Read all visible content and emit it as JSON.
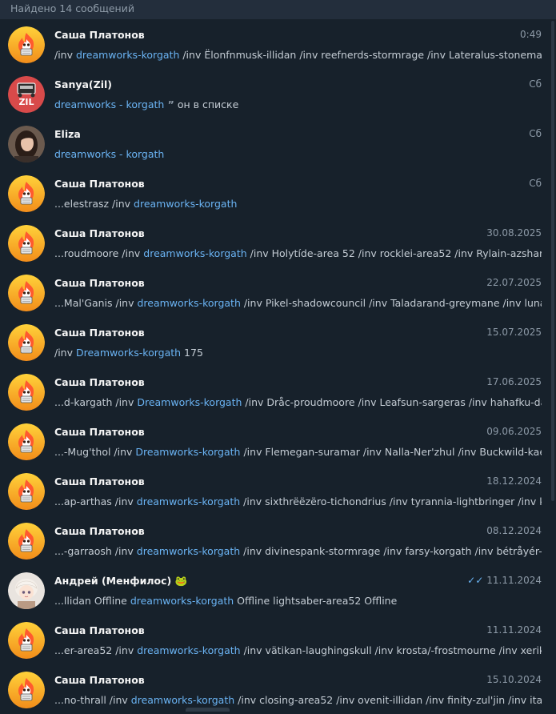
{
  "header": {
    "title": "Найдено 14 сообщений"
  },
  "results": [
    {
      "name": "Саша Платонов",
      "date": "0:49",
      "avatar": "fire-sticker",
      "pre": "/inv ",
      "hl": "dreamworks-korgath",
      "post": " /inv Ëlonfnmusk-illidan /inv reefnerds-stormrage /inv Lateralus-stonemaul"
    },
    {
      "name": "Sanya(Zil)",
      "date": "Сб",
      "avatar": "zil",
      "pre": "",
      "hl": "dreamworks - korgath",
      "quote": " ”",
      "post": " он в списке"
    },
    {
      "name": "Eliza",
      "date": "Сб",
      "avatar": "photo-eliza",
      "pre": "",
      "hl": "dreamworks - korgath",
      "post": ""
    },
    {
      "name": "Саша Платонов",
      "date": "Сб",
      "avatar": "fire-sticker",
      "pre": "...elestrasz /inv ",
      "hl": "dreamworks-korgath",
      "post": ""
    },
    {
      "name": "Саша Платонов",
      "date": "30.08.2025",
      "avatar": "fire-sticker",
      "pre": "...roudmoore /inv ",
      "hl": "dreamworks-korgath",
      "post": " /inv Holytíde-area 52 /inv rocklei-area52 /inv Rylain-azshara /i..."
    },
    {
      "name": "Саша Платонов",
      "date": "22.07.2025",
      "avatar": "fire-sticker",
      "pre": "...Mal'Ganis /inv ",
      "hl": "dreamworks-korgath",
      "post": " /inv Pikel-shadowcouncil /inv Taladarand-greymane /inv lunari..."
    },
    {
      "name": "Саша Платонов",
      "date": "15.07.2025",
      "avatar": "fire-sticker",
      "pre": "/inv ",
      "hl": "Dreamworks-korgath",
      "post": " 175"
    },
    {
      "name": "Саша Платонов",
      "date": "17.06.2025",
      "avatar": "fire-sticker",
      "pre": "...d-kargath /inv ",
      "hl": "Dreamworks-korgath",
      "post": " /inv Dråc-proudmoore /inv Leafsun-sargeras /inv hahafku-darr..."
    },
    {
      "name": "Саша Платонов",
      "date": "09.06.2025",
      "avatar": "fire-sticker",
      "pre": "...-Mug'thol /inv ",
      "hl": "Dreamworks-korgath",
      "post": " /inv Flemegan-suramar /inv Nalla-Ner'zhul /inv Buckwild-kael't..."
    },
    {
      "name": "Саша Платонов",
      "date": "18.12.2024",
      "avatar": "fire-sticker",
      "pre": "...ap-arthas /inv ",
      "hl": "dreamworks-korgath",
      "post": " /inv sixthrëëzëro-tichondrius /inv tyrannia-lightbringer /inv ko..."
    },
    {
      "name": "Саша Платонов",
      "date": "08.12.2024",
      "avatar": "fire-sticker",
      "pre": "...-garraosh /inv ",
      "hl": "dreamworks-korgath",
      "post": " /inv divinespank-stormrage /inv farsy-korgath /inv bétråyér-st..."
    },
    {
      "name": "Андрей (Менфилос) 🐸",
      "date": "11.11.2024",
      "avatar": "anime-girl",
      "checks": "✓✓",
      "pre": "...llidan Offline ",
      "hl": "dreamworks-korgath",
      "post": " Offline lightsaber-area52 Offline"
    },
    {
      "name": "Саша Платонов",
      "date": "11.11.2024",
      "avatar": "fire-sticker",
      "pre": "...er-area52 /inv ",
      "hl": "dreamworks-korgath",
      "post": " /inv vätikan-laughingskull /inv krosta/-frostmourne /inv xerik-el..."
    },
    {
      "name": "Саша Платонов",
      "date": "15.10.2024",
      "avatar": "fire-sticker",
      "pre": "...no-thrall /inv ",
      "hl": "dreamworks-korgath",
      "post": " /inv closing-area52 /inv ovenit-illidan /inv finity-zul'jin /inv itarge..."
    }
  ],
  "colors": {
    "background": "#17212b",
    "header_bg": "#232e3c",
    "highlight": "#6ab3f3",
    "muted": "#8d9aa7"
  }
}
